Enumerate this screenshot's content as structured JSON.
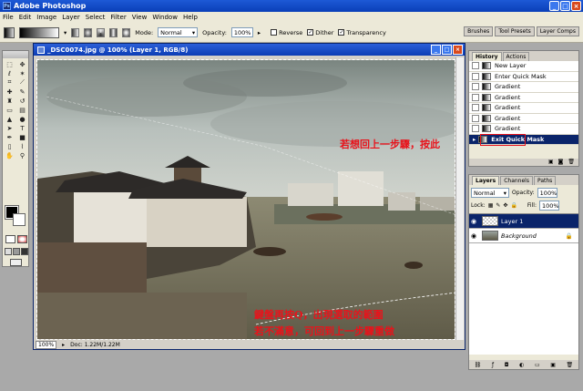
{
  "app": {
    "title": "Adobe Photoshop"
  },
  "menu": [
    "File",
    "Edit",
    "Image",
    "Layer",
    "Select",
    "Filter",
    "View",
    "Window",
    "Help"
  ],
  "options": {
    "mode_label": "Mode:",
    "mode_value": "Normal",
    "opacity_label": "Opacity:",
    "opacity_value": "100%",
    "reverse_label": "Reverse",
    "dither_label": "Dither",
    "transparency_label": "Transparency"
  },
  "palette_well": [
    "Brushes",
    "Tool Presets",
    "Layer Comps"
  ],
  "document": {
    "title": "_DSC0074.jpg @ 100% (Layer 1, RGB/8)",
    "zoom": "100%",
    "doc_size": "Doc: 1.22M/1.22M"
  },
  "annotations": {
    "top": "若想回上一步驟，按此",
    "bottom_line1": "鍵盤再按Q，出現選取的範圍",
    "bottom_line2": "若不滿意，可回到上一步驟重做"
  },
  "history": {
    "tabs": [
      "History",
      "Actions"
    ],
    "items": [
      "New Layer",
      "Enter Quick Mask",
      "Gradient",
      "Gradient",
      "Gradient",
      "Gradient",
      "Gradient",
      "Exit Quick Mask"
    ]
  },
  "layers": {
    "tabs": [
      "Layers",
      "Channels",
      "Paths"
    ],
    "blend_mode": "Normal",
    "opacity_label": "Opacity:",
    "opacity_value": "100%",
    "lock_label": "Lock:",
    "fill_label": "Fill:",
    "fill_value": "100%",
    "rows": [
      "Layer 1",
      "Background"
    ]
  },
  "colors": {
    "annotation_red": "#e8131b",
    "xp_blue": "#0a3fb8",
    "selection": "#0a246a"
  }
}
